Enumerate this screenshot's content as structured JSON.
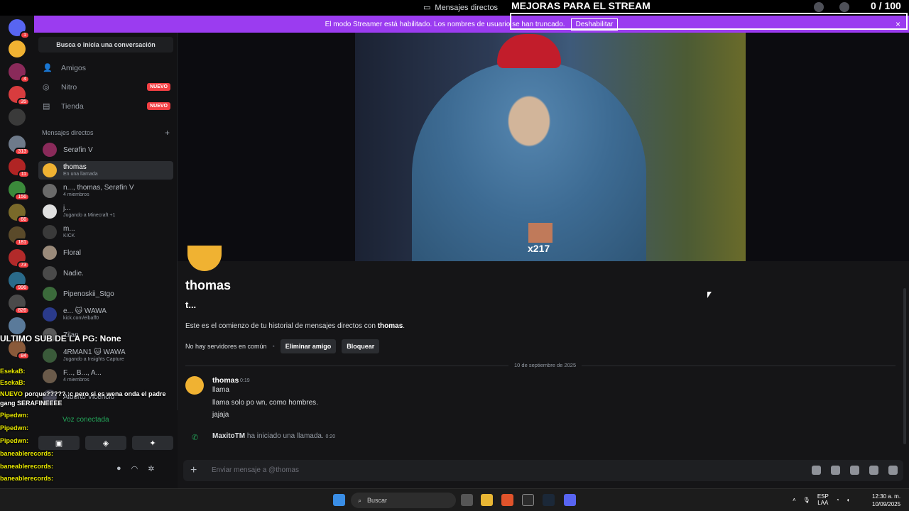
{
  "window": {
    "title": "Mensajes directos",
    "overlay_banner": "MEJORAS PARA EL STREAM",
    "counter": "0 / 100"
  },
  "streamer_bar": {
    "message": "El modo Streamer está habilitado. Los nombres de usuario se han truncado.",
    "disable_label": "Deshabilitar",
    "close": "×"
  },
  "guilds": [
    {
      "color": "#5865f2",
      "badge": "1"
    },
    {
      "color": "#f0b232",
      "badge": ""
    },
    {
      "color": "#8a2a5a",
      "badge": "4"
    },
    {
      "color": "#d83c3e",
      "badge": "35"
    },
    {
      "color": "#3a3a3a",
      "badge": ""
    },
    {
      "color": "#6e7a8a",
      "badge": "313"
    },
    {
      "color": "#b02424",
      "badge": "11"
    },
    {
      "color": "#3b8a3b",
      "badge": "156"
    },
    {
      "color": "#7a6a2a",
      "badge": "66"
    },
    {
      "color": "#5a4a2a",
      "badge": "181"
    },
    {
      "color": "#b22a2a",
      "badge": "73"
    },
    {
      "color": "#2a6a8a",
      "badge": "996"
    },
    {
      "color": "#4a4a4a",
      "badge": "826"
    },
    {
      "color": "#5a7a9a",
      "badge": ""
    },
    {
      "color": "#8a5a3a",
      "badge": "84"
    }
  ],
  "sidebar": {
    "search_label": "Busca o inicia una conversación",
    "nav": [
      {
        "label": "Amigos",
        "badge": ""
      },
      {
        "label": "Nitro",
        "badge": "NUEVO"
      },
      {
        "label": "Tienda",
        "badge": "NUEVO"
      }
    ],
    "dm_header": "Mensajes directos",
    "dm_add": "+",
    "dms": [
      {
        "name": "Serøfin V",
        "sub": "",
        "color": "#8a2a5a"
      },
      {
        "name": "thomas",
        "sub": "En una llamada",
        "color": "#f0b232",
        "active": true
      },
      {
        "name": "n..., thomas, Serøfin V",
        "sub": "4 miembros",
        "color": "#6a6a6a"
      },
      {
        "name": "j...",
        "sub": "Jugando a Minecraft +1",
        "color": "#e0e0e0"
      },
      {
        "name": "m...",
        "sub": "KICK",
        "color": "#3a3a3a"
      },
      {
        "name": "Floral",
        "sub": "",
        "color": "#9a8a7a"
      },
      {
        "name": "Nadie.",
        "sub": "",
        "color": "#4a4a4a"
      },
      {
        "name": "Pipenoskii_Stgo",
        "sub": "",
        "color": "#3b6a3b"
      },
      {
        "name": "e... 🐱 WAWA",
        "sub": "kick.com/elbaff0",
        "color": "#2a3a8a"
      },
      {
        "name": "Zilan",
        "sub": "",
        "color": "#5a5a5a"
      },
      {
        "name": "4RMAN1 🐱 WAWA",
        "sub": "Jugando a Insights Capture",
        "color": "#3a5a3a"
      },
      {
        "name": "F..., B..., A...",
        "sub": "4 miembros",
        "color": "#6a5a4a"
      },
      {
        "name": "Alberto Vicencio",
        "sub": "",
        "color": "#4a4a5a"
      }
    ],
    "voice_status": "Voz conectada",
    "user_status": "En una llamada"
  },
  "chat": {
    "profile_name": "thomas",
    "profile_handle": "t...",
    "intro_prefix": "Este es el comienzo de tu historial de mensajes directos con ",
    "intro_name": "thomas",
    "intro_suffix": ".",
    "no_servers": "No hay servidores en común",
    "dot": "•",
    "remove_friend": "Eliminar amigo",
    "block": "Bloquear",
    "date_divider": "10 de septiembre de 2025",
    "message": {
      "author": "thomas",
      "time": "0:19",
      "lines": [
        "llama",
        "llama solo po wn, como hombres.",
        "jajaja"
      ]
    },
    "call": {
      "author": "MaxitoTM",
      "text": " ha iniciado una llamada.",
      "time": "0:20"
    },
    "composer_placeholder": "Enviar mensaje a @thomas",
    "stream_emote_count": "x217"
  },
  "overlay_chat": {
    "last_sub": "ULTIMO SUB DE LA PG: None",
    "lines": [
      {
        "name": "EsekaB:",
        "text": ""
      },
      {
        "name": "EsekaB:",
        "text": ""
      },
      {
        "name": "NUEVO",
        "text": "porque????? :c pero si es wena onda el padre"
      },
      {
        "name": "",
        "text": "gang SERAFINEEEE"
      },
      {
        "name": "Pipedwn:",
        "text": ""
      },
      {
        "name": "Pipedwn:",
        "text": ""
      },
      {
        "name": "Pipedwn:",
        "text": ""
      },
      {
        "name": "baneablerecords:",
        "text": ""
      },
      {
        "name": "baneablerecords:",
        "text": ""
      },
      {
        "name": "baneablerecords:",
        "text": ""
      },
      {
        "name": "baneablerecords:",
        "text": ""
      }
    ]
  },
  "taskbar": {
    "search_placeholder": "Buscar",
    "lang_top": "ESP",
    "lang_bottom": "LAA",
    "time": "12:30 a. m.",
    "date": "10/09/2025"
  }
}
